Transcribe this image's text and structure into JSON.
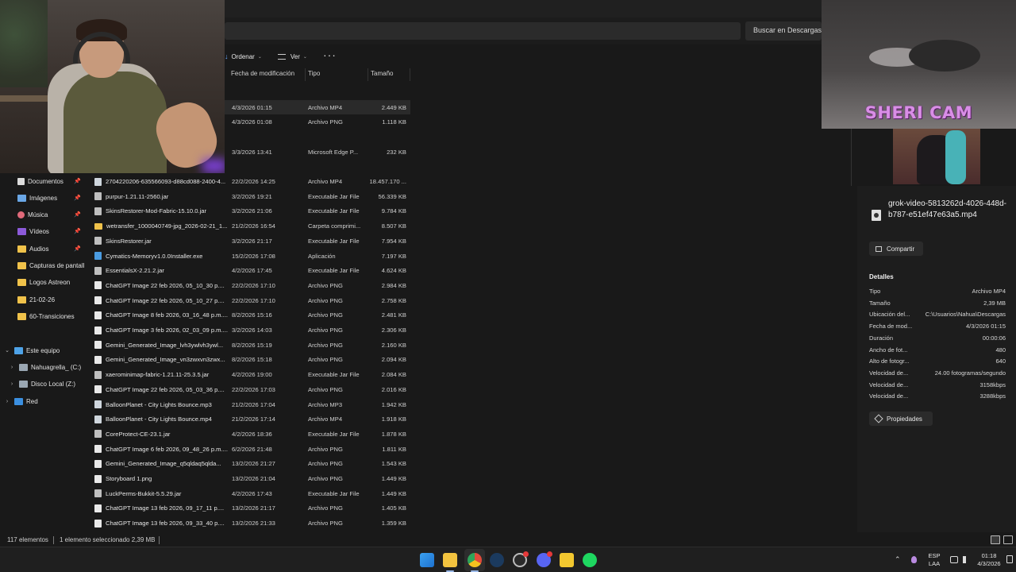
{
  "search": {
    "label": "Buscar en Descargas"
  },
  "toolbar": {
    "sort_label": "Ordenar",
    "view_label": "Ver",
    "more_label": "···"
  },
  "columns": {
    "date": "Fecha de modificación",
    "type": "Tipo",
    "size": "Tamaño"
  },
  "sidebar": {
    "items": [
      {
        "label": "Documentos",
        "icon": "document-icon",
        "pinned": true
      },
      {
        "label": "Imágenes",
        "icon": "image-icon",
        "pinned": true
      },
      {
        "label": "Música",
        "icon": "music-icon",
        "pinned": true
      },
      {
        "label": "Vídeos",
        "icon": "video-icon",
        "pinned": true
      },
      {
        "label": "Audios",
        "icon": "folder-icon",
        "pinned": true
      },
      {
        "label": "Capturas de pantall",
        "icon": "folder-icon",
        "pinned": false
      },
      {
        "label": "Logos Astreon",
        "icon": "folder-icon",
        "pinned": false
      },
      {
        "label": "21-02-26",
        "icon": "folder-icon",
        "pinned": false
      },
      {
        "label": "60-Transiciones",
        "icon": "folder-icon",
        "pinned": false
      }
    ],
    "this_pc": "Este equipo",
    "drives": [
      "Nahuagrella_ (C:)",
      "Disco Local (Z:)"
    ],
    "network": "Red"
  },
  "files": [
    {
      "name": "",
      "date": "4/3/2026 01:15",
      "type": "Archivo MP4",
      "size": "2.449 KB",
      "kind": "mp4",
      "selected": true,
      "slot": 0
    },
    {
      "name": "",
      "date": "4/3/2026 01:08",
      "type": "Archivo PNG",
      "size": "1.118 KB",
      "kind": "png",
      "slot": 1
    },
    {
      "name": "",
      "date": "3/3/2026 13:41",
      "type": "Microsoft Edge P...",
      "size": "232 KB",
      "kind": "web",
      "slot": 3
    },
    {
      "name": "2704220206-635566093-d88cd088-2400-4...",
      "date": "22/2/2026 14:25",
      "type": "Archivo MP4",
      "size": "18.457.170 ...",
      "kind": "mp4",
      "slot": 5
    },
    {
      "name": "purpur-1.21.11-2560.jar",
      "date": "3/2/2026 19:21",
      "type": "Executable Jar File",
      "size": "56.339 KB",
      "kind": "jar",
      "slot": 6
    },
    {
      "name": "SkinsRestorer-Mod-Fabric-15.10.0.jar",
      "date": "3/2/2026 21:06",
      "type": "Executable Jar File",
      "size": "9.784 KB",
      "kind": "jar",
      "slot": 7
    },
    {
      "name": "wetransfer_1000040749-jpg_2026-02-21_1...",
      "date": "21/2/2026 16:54",
      "type": "Carpeta comprimi...",
      "size": "8.507 KB",
      "kind": "folder",
      "slot": 8
    },
    {
      "name": "SkinsRestorer.jar",
      "date": "3/2/2026 21:17",
      "type": "Executable Jar File",
      "size": "7.954 KB",
      "kind": "jar",
      "slot": 9
    },
    {
      "name": "Cymatics-Memoryv1.0.0Installer.exe",
      "date": "15/2/2026 17:08",
      "type": "Aplicación",
      "size": "7.197 KB",
      "kind": "exe",
      "slot": 10
    },
    {
      "name": "EssentialsX-2.21.2.jar",
      "date": "4/2/2026 17:45",
      "type": "Executable Jar File",
      "size": "4.624 KB",
      "kind": "jar",
      "slot": 11
    },
    {
      "name": "ChatGPT Image 22 feb 2026, 05_10_30 p....",
      "date": "22/2/2026 17:10",
      "type": "Archivo PNG",
      "size": "2.984 KB",
      "kind": "png",
      "slot": 12
    },
    {
      "name": "ChatGPT Image 22 feb 2026, 05_10_27 p....",
      "date": "22/2/2026 17:10",
      "type": "Archivo PNG",
      "size": "2.758 KB",
      "kind": "png",
      "slot": 13
    },
    {
      "name": "ChatGPT Image 8 feb 2026, 03_16_48 p.m....",
      "date": "8/2/2026 15:16",
      "type": "Archivo PNG",
      "size": "2.481 KB",
      "kind": "png",
      "slot": 14
    },
    {
      "name": "ChatGPT Image 3 feb 2026, 02_03_09 p.m....",
      "date": "3/2/2026 14:03",
      "type": "Archivo PNG",
      "size": "2.306 KB",
      "kind": "png",
      "slot": 15
    },
    {
      "name": "Gemini_Generated_Image_lvh3ywlvh3ywl...",
      "date": "8/2/2026 15:19",
      "type": "Archivo PNG",
      "size": "2.160 KB",
      "kind": "png",
      "slot": 16
    },
    {
      "name": "Gemini_Generated_Image_vn3zwxvn3zwx...",
      "date": "8/2/2026 15:18",
      "type": "Archivo PNG",
      "size": "2.094 KB",
      "kind": "png",
      "slot": 17
    },
    {
      "name": "xaerominimap-fabric-1.21.11-25.3.5.jar",
      "date": "4/2/2026 19:00",
      "type": "Executable Jar File",
      "size": "2.084 KB",
      "kind": "jar",
      "slot": 18
    },
    {
      "name": "ChatGPT Image 22 feb 2026, 05_03_36 p....",
      "date": "22/2/2026 17:03",
      "type": "Archivo PNG",
      "size": "2.016 KB",
      "kind": "png",
      "slot": 19
    },
    {
      "name": "BalloonPlanet - City Lights Bounce.mp3",
      "date": "21/2/2026 17:04",
      "type": "Archivo MP3",
      "size": "1.942 KB",
      "kind": "mp3",
      "slot": 20
    },
    {
      "name": "BalloonPlanet - City Lights Bounce.mp4",
      "date": "21/2/2026 17:14",
      "type": "Archivo MP4",
      "size": "1.918 KB",
      "kind": "mp4",
      "slot": 21
    },
    {
      "name": "CoreProtect-CE-23.1.jar",
      "date": "4/2/2026 18:36",
      "type": "Executable Jar File",
      "size": "1.878 KB",
      "kind": "jar",
      "slot": 22
    },
    {
      "name": "ChatGPT Image 6 feb 2026, 09_48_26 p.m....",
      "date": "6/2/2026 21:48",
      "type": "Archivo PNG",
      "size": "1.811 KB",
      "kind": "png",
      "slot": 23
    },
    {
      "name": "Gemini_Generated_Image_q5qldaq5qlda...",
      "date": "13/2/2026 21:27",
      "type": "Archivo PNG",
      "size": "1.543 KB",
      "kind": "png",
      "slot": 24
    },
    {
      "name": "Storyboard 1.png",
      "date": "13/2/2026 21:04",
      "type": "Archivo PNG",
      "size": "1.449 KB",
      "kind": "png",
      "slot": 25
    },
    {
      "name": "LuckPerms-Bukkit-5.5.29.jar",
      "date": "4/2/2026 17:43",
      "type": "Executable Jar File",
      "size": "1.449 KB",
      "kind": "jar",
      "slot": 26
    },
    {
      "name": "ChatGPT Image 13 feb 2026, 09_17_11 p....",
      "date": "13/2/2026 21:17",
      "type": "Archivo PNG",
      "size": "1.405 KB",
      "kind": "png",
      "slot": 27
    },
    {
      "name": "ChatGPT Image 13 feb 2026, 09_33_40 p....",
      "date": "13/2/2026 21:33",
      "type": "Archivo PNG",
      "size": "1.359 KB",
      "kind": "png",
      "slot": 28
    }
  ],
  "overlay": {
    "cam_title": "SHERI CAM"
  },
  "details": {
    "filename": "grok-video-5813262d-4026-448d-b787-e51ef47e63a5.mp4",
    "share_label": "Compartir",
    "heading": "Detalles",
    "rows": [
      {
        "k": "Tipo",
        "v": "Archivo MP4"
      },
      {
        "k": "Tamaño",
        "v": "2,39 MB"
      },
      {
        "k": "Ubicación del...",
        "v": "C:\\Usuarios\\Nahua\\Descargas"
      },
      {
        "k": "Fecha de mod...",
        "v": "4/3/2026 01:15"
      },
      {
        "k": "Duración",
        "v": "00:00:06"
      },
      {
        "k": "Ancho de fot...",
        "v": "480"
      },
      {
        "k": "Alto de fotogr...",
        "v": "640"
      },
      {
        "k": "Velocidad de...",
        "v": "24.00 fotogramas/segundo"
      },
      {
        "k": "Velocidad de...",
        "v": "3158kbps"
      },
      {
        "k": "Velocidad de...",
        "v": "3288kbps"
      }
    ],
    "properties_label": "Propiedades"
  },
  "status": {
    "count": "117 elementos",
    "selection": "1 elemento seleccionado 2,39 MB"
  },
  "taskbar": {
    "lang_line1": "ESP",
    "lang_line2": "LAA",
    "time": "01:18",
    "date": "4/3/2026"
  }
}
